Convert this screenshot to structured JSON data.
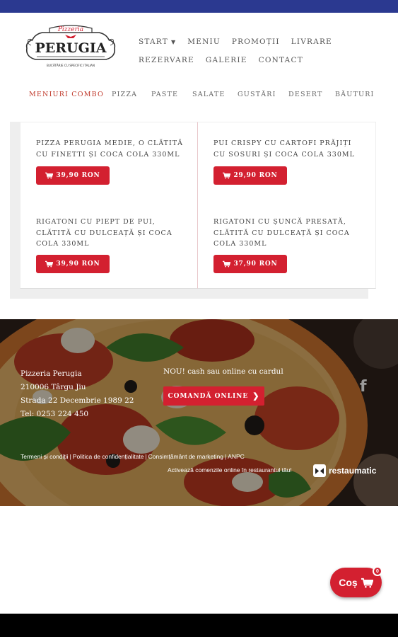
{
  "logo": {
    "top_text": "Pizzeria",
    "name": "PERUGIA",
    "tagline": "BUCĂTĂRIE CU SPECIFIC ITALIAN"
  },
  "main_nav": {
    "row1": [
      "START",
      "MENIU",
      "PROMOȚII",
      "LIVRARE"
    ],
    "row2": [
      "REZERVARE",
      "GALERIE",
      "CONTACT"
    ]
  },
  "categories": [
    "MENIURI COMBO",
    "PIZZA",
    "PASTE",
    "SALATE",
    "GUSTĂRI",
    "DESERT",
    "BĂUTURI"
  ],
  "products": [
    {
      "title": "PIZZA PERUGIA MEDIE, O CLĂTITĂ CU FINETTI ȘI COCA COLA 330ML",
      "price": "39,90 RON"
    },
    {
      "title": "PUI CRISPY CU CARTOFI PRĂJIȚI CU SOSURI ȘI COCA COLA 330ML",
      "price": "29,90 RON"
    },
    {
      "title": "RIGATONI CU PIEPT DE PUI, CLĂTITĂ CU DULCEAȚĂ ȘI COCA COLA 330ML",
      "price": "39,90 RON"
    },
    {
      "title": "RIGATONI CU ȘUNCĂ PRESATĂ, CLĂTITĂ CU DULCEAȚĂ ȘI COCA COLA 330ML",
      "price": "37,90 RON"
    }
  ],
  "footer": {
    "address": [
      "Pizzeria Perugia",
      "210006 Târgu Jiu",
      "Strada 22 Decembrie 1989 22",
      "Tel: 0253 224 450"
    ],
    "order_text": "NOU! cash sau online cu cardul",
    "order_button": "COMANDĂ ONLINE",
    "links": [
      "Termeni și condiții",
      "Politica de confidențialitate",
      "Consimțământ de marketing",
      "ANPC"
    ],
    "link_separator": "|",
    "activate_text": "Activează comenzile online în restaurantul tău!",
    "brand": "restaumatic"
  },
  "cart": {
    "label": "Coș",
    "count": "0"
  },
  "colors": {
    "accent": "#d32030",
    "topbar": "#2b3990",
    "active_category": "#c0392b"
  }
}
